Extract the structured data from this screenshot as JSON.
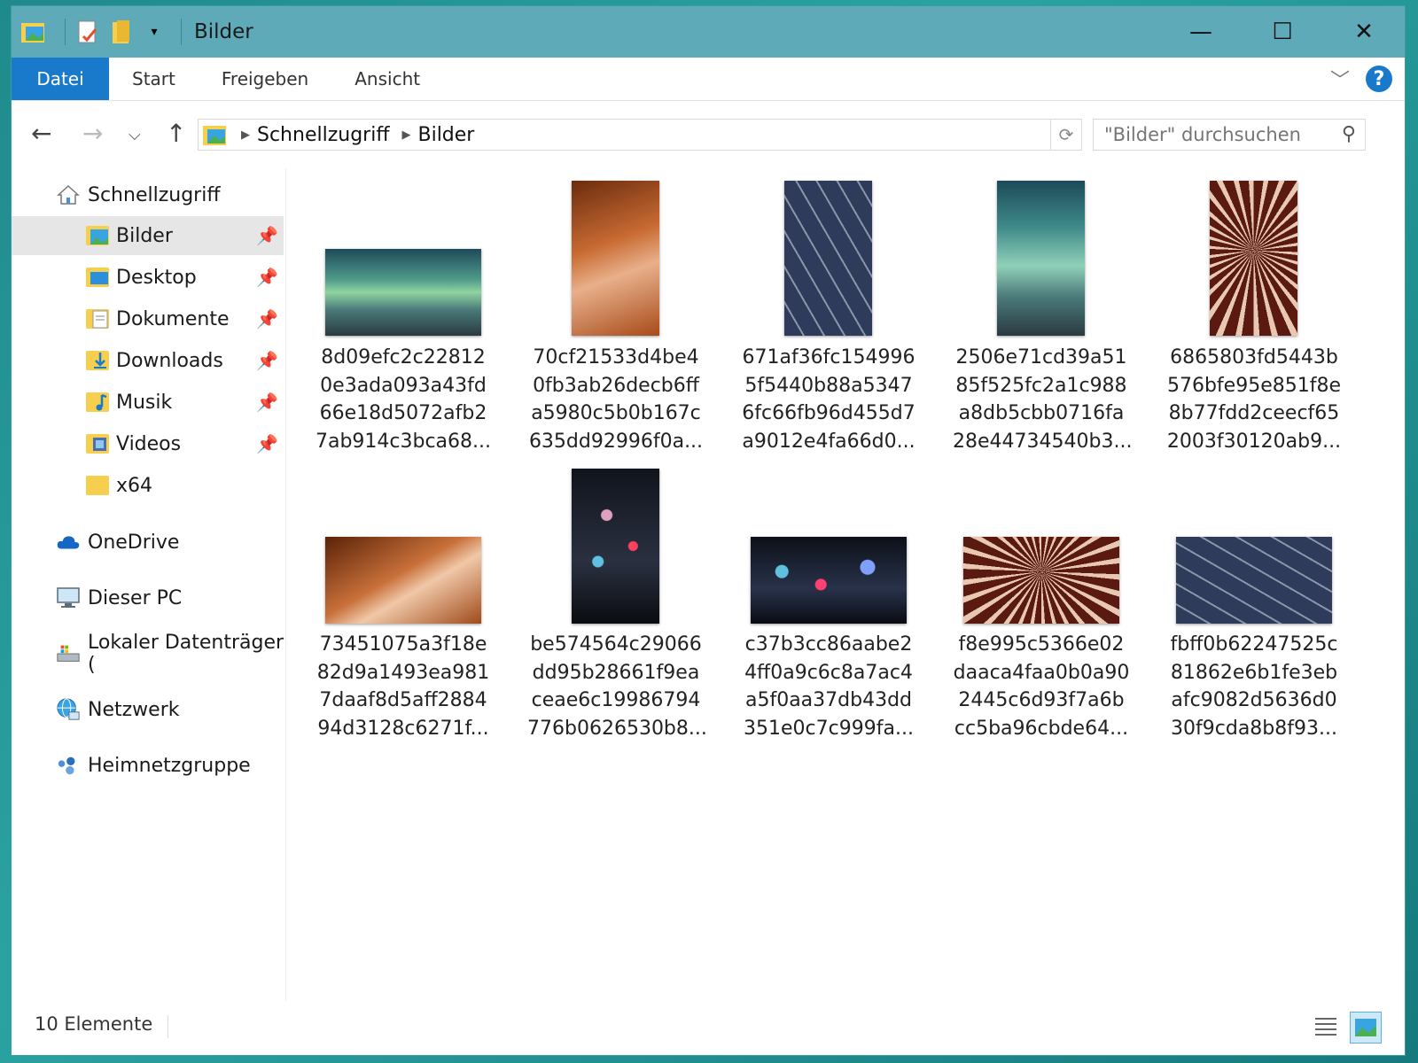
{
  "window": {
    "title": "Bilder",
    "controls": {
      "minimize": "—",
      "maximize": "☐",
      "close": "✕"
    }
  },
  "ribbon": {
    "tabs": [
      "Datei",
      "Start",
      "Freigeben",
      "Ansicht"
    ],
    "help": "?"
  },
  "navigation": {
    "breadcrumb": [
      "Schnellzugriff",
      "Bilder"
    ],
    "search_placeholder": "\"Bilder\" durchsuchen"
  },
  "sidebar": {
    "quick_access": "Schnellzugriff",
    "pinned": [
      "Bilder",
      "Desktop",
      "Dokumente",
      "Downloads",
      "Musik",
      "Videos"
    ],
    "unpinned": [
      "x64"
    ],
    "roots": [
      "OneDrive",
      "Dieser PC",
      "Lokaler Datenträger (",
      "Netzwerk",
      "Heimnetzgruppe"
    ]
  },
  "files": [
    {
      "name": "8d09efc2c22812\n0e3ada093a43fd\n66e18d5072afb2\n7ab914c3bca68..."
    },
    {
      "name": "70cf21533d4be4\n0fb3ab26decb6ff\na5980c5b0b167c\n635dd92996f0a..."
    },
    {
      "name": "671af36fc154996\n5f5440b88a5347\n6fc66fb96d455d7\na9012e4fa66d0..."
    },
    {
      "name": "2506e71cd39a51\n85f525fc2a1c988\na8db5cbb0716fa\n28e44734540b3..."
    },
    {
      "name": "6865803fd5443b\n576bfe95e851f8e\n8b77fdd2ceecf65\n2003f30120ab9..."
    },
    {
      "name": "73451075a3f18e\n82d9a1493ea981\n7daaf8d5aff2884\n94d3128c6271f..."
    },
    {
      "name": "be574564c29066\ndd95b28661f9ea\nceae6c19986794\n776b0626530b8..."
    },
    {
      "name": "c37b3cc86aabe2\n4ff0a9c6c8a7ac4\na5f0aa37db43dd\n351e0c7c999fa..."
    },
    {
      "name": "f8e995c5366e02\ndaaca4faa0b0a90\n2445c6d93f7a6b\ncc5ba96cbde64..."
    },
    {
      "name": "fbff0b62247525c\n81862e6b1fe3eb\nafc9082d5636d0\n30f9cda8b8f93..."
    }
  ],
  "status": {
    "count": "10 Elemente"
  }
}
